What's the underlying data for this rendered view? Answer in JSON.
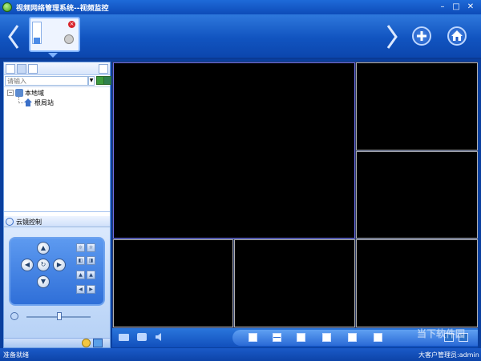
{
  "window": {
    "title": "视频网络管理系统--视频监控"
  },
  "toolbar": {
    "prev": "‹",
    "next": "›"
  },
  "left_panel": {
    "search_placeholder": "请输入",
    "tree": [
      {
        "label": "本地域"
      },
      {
        "label": "根局站"
      }
    ],
    "ptz_title": "云镜控制"
  },
  "status": {
    "left": "准备就绪",
    "right": "大客户管理员:admin"
  },
  "watermark": "当下软件园",
  "colors": {
    "accent": "#1154c0",
    "video_bg": "#000000",
    "active_border": "#6f6fe8"
  }
}
